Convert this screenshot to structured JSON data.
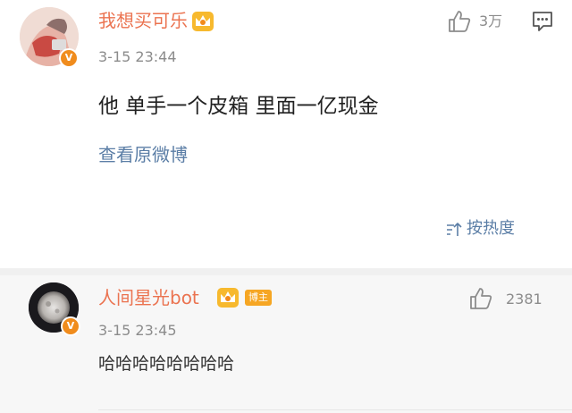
{
  "main_comment": {
    "username": "我想买可乐",
    "time": "3-15 23:44",
    "like_count": "3万",
    "body": "他 单手一个皮箱 里面一亿现金",
    "view_original": "查看原微博",
    "sort_label": "按热度",
    "verified_badge": "V"
  },
  "reply": {
    "username": "人间星光bot",
    "tag": "博主",
    "time": "3-15 23:45",
    "like_count": "2381",
    "body": "哈哈哈哈哈哈哈哈",
    "verified_badge": "V"
  },
  "colors": {
    "username": "#eb7350",
    "link": "#5b7ea6",
    "badge": "#f08c1d",
    "reply_bg": "#f7f7f7"
  }
}
